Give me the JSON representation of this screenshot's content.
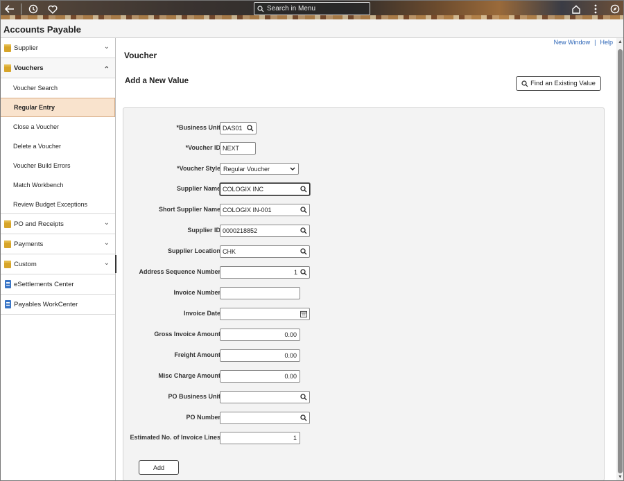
{
  "topbar": {
    "search_placeholder": "Search in Menu",
    "icons": [
      "back-arrow-icon",
      "history-icon",
      "favorites-heart-icon",
      "home-icon",
      "actions-kebab-icon",
      "navigator-compass-icon"
    ]
  },
  "app_title": "Accounts Payable",
  "sidebar": {
    "items": [
      {
        "label": "Supplier",
        "chevron": "⌄"
      },
      {
        "label": "Vouchers",
        "chevron": "⌃"
      },
      {
        "label": "PO and Receipts",
        "chevron": "⌄"
      },
      {
        "label": "Payments",
        "chevron": "⌄"
      },
      {
        "label": "Custom",
        "chevron": "⌄"
      },
      {
        "label": "eSettlements Center"
      },
      {
        "label": "Payables WorkCenter"
      }
    ],
    "voucher_subitems": [
      {
        "label": "Voucher Search"
      },
      {
        "label": "Regular Entry"
      },
      {
        "label": "Close a Voucher"
      },
      {
        "label": "Delete a Voucher"
      },
      {
        "label": "Voucher Build Errors"
      },
      {
        "label": "Match Workbench"
      },
      {
        "label": "Review Budget Exceptions"
      }
    ]
  },
  "main": {
    "links": {
      "new_window": "New Window",
      "separator": "|",
      "help": "Help"
    },
    "page_title": "Voucher",
    "section_title": "Add a New Value",
    "find_button": "Find an Existing Value",
    "add_button": "Add",
    "fields": {
      "business_unit": {
        "label": "*Business Unit",
        "value": "DAS01"
      },
      "voucher_id": {
        "label": "*Voucher ID",
        "value": "NEXT"
      },
      "voucher_style": {
        "label": "*Voucher Style",
        "value": "Regular Voucher"
      },
      "supplier_name": {
        "label": "Supplier Name",
        "value": "COLOGIX INC"
      },
      "short_supplier_name": {
        "label": "Short Supplier Name",
        "value": "COLOGIX IN-001"
      },
      "supplier_id": {
        "label": "Supplier ID",
        "value": "0000218852"
      },
      "supplier_location": {
        "label": "Supplier Location",
        "value": "CHK"
      },
      "address_seq": {
        "label": "Address Sequence Number",
        "value": "1"
      },
      "invoice_number": {
        "label": "Invoice Number",
        "value": ""
      },
      "invoice_date": {
        "label": "Invoice Date",
        "value": ""
      },
      "gross_invoice_amount": {
        "label": "Gross Invoice Amount",
        "value": "0.00"
      },
      "freight_amount": {
        "label": "Freight Amount",
        "value": "0.00"
      },
      "misc_charge_amount": {
        "label": "Misc Charge Amount",
        "value": "0.00"
      },
      "po_business_unit": {
        "label": "PO Business Unit",
        "value": ""
      },
      "po_number": {
        "label": "PO Number",
        "value": ""
      },
      "est_invoice_lines": {
        "label": "Estimated No. of Invoice Lines",
        "value": "1"
      }
    }
  },
  "colors": {
    "accent_link": "#2b64b6",
    "active_item_bg": "#f9e3cd",
    "folder": "#d7a52a"
  }
}
